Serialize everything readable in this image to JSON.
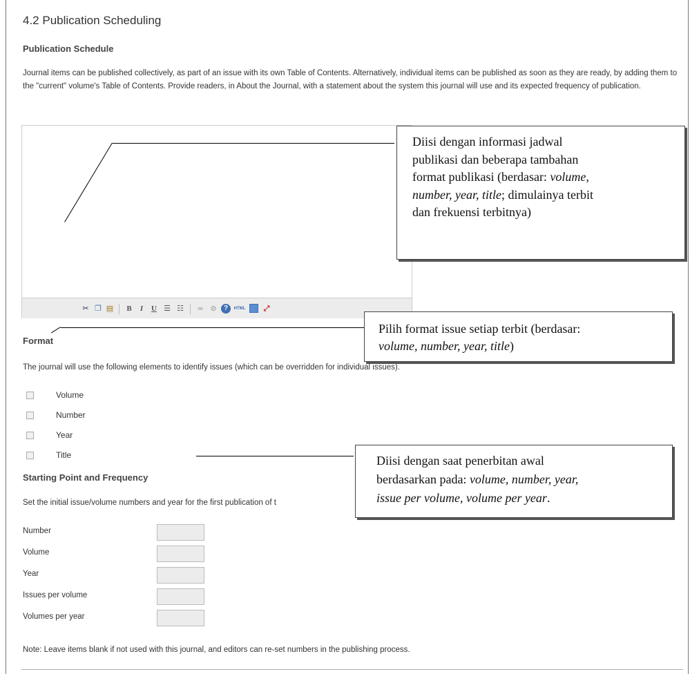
{
  "section_title": "4.2 Publication Scheduling",
  "schedule_heading": "Publication Schedule",
  "schedule_description": "Journal items can be published collectively, as part of an issue with its own Table of Contents. Alternatively, individual items can be published as soon as they are ready, by adding them to the \"current\" volume's Table of Contents. Provide readers, in About the Journal, with a statement about the system this journal will use and its expected frequency of publication.",
  "editor": {
    "toolbar": [
      "cut-icon",
      "copy-icon",
      "paste-icon",
      "bold-icon",
      "italic-icon",
      "underline-icon",
      "bullet-list-icon",
      "numbered-list-icon",
      "link-icon",
      "unlink-icon",
      "help-icon",
      "html-icon",
      "image-icon",
      "fullscreen-icon"
    ]
  },
  "format": {
    "heading": "Format",
    "description": "The journal will use the following elements to identify issues (which can be overridden for individual issues).",
    "options": [
      {
        "label": "Volume",
        "checked": false
      },
      {
        "label": "Number",
        "checked": false
      },
      {
        "label": "Year",
        "checked": false
      },
      {
        "label": "Title",
        "checked": false
      }
    ]
  },
  "starting": {
    "heading": "Starting Point and Frequency",
    "description": "Set the initial issue/volume numbers and year for the first publication of t",
    "fields": [
      {
        "label": "Number",
        "value": ""
      },
      {
        "label": "Volume",
        "value": ""
      },
      {
        "label": "Year",
        "value": ""
      },
      {
        "label": "Issues per volume",
        "value": ""
      },
      {
        "label": "Volumes per year",
        "value": ""
      }
    ]
  },
  "note": "Note: Leave items blank if not used with this journal, and editors can re-set numbers in the publishing process.",
  "callouts": {
    "one": {
      "line1": "Diisi dengan informasi jadwal",
      "line2": "publikasi dan beberapa tambahan",
      "line3": "format publikasi (berdasar: ",
      "line3_italic": "volume,",
      "line4_italic": "number, year, title",
      "line4": "; dimulainya terbit",
      "line5": "dan frekuensi terbitnya)"
    },
    "two": {
      "line1": "Pilih format issue setiap terbit (berdasar:",
      "line2_italic": "volume, number, year, title",
      "line2": ")"
    },
    "three": {
      "line1": "Diisi dengan saat penerbitan awal",
      "line2": "berdasarkan pada: ",
      "line2_italic": "volume, number, year,",
      "line3_italic": "issue per volume, volume per year",
      "line3": "."
    }
  }
}
